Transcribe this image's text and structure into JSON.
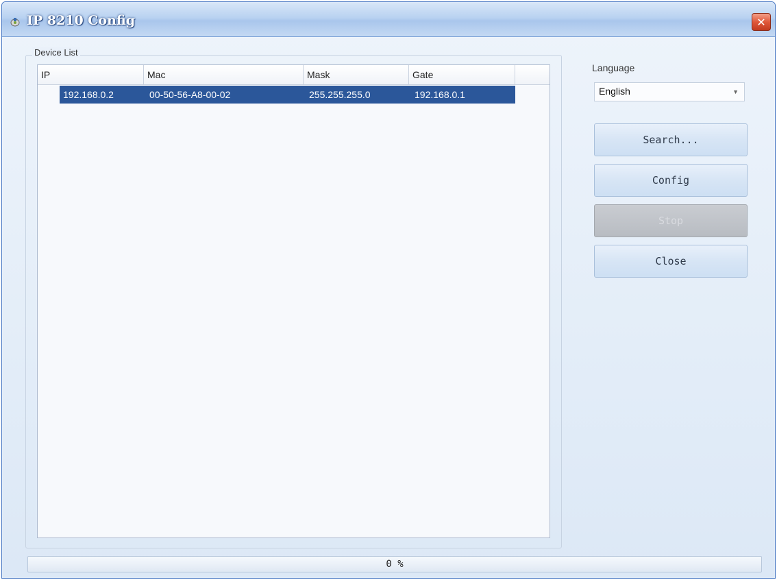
{
  "window": {
    "title": "IP 8210 Config",
    "close_glyph": "✕",
    "icons": {
      "app": "app-icon",
      "close": "close-icon"
    }
  },
  "device_list": {
    "label": "Device List",
    "columns": [
      "IP",
      "Mac",
      "Mask",
      "Gate"
    ],
    "rows": [
      {
        "ip": "192.168.0.2",
        "mac": "00-50-56-A8-00-02",
        "mask": "255.255.255.0",
        "gate": "192.168.0.1",
        "selected": true
      }
    ]
  },
  "language": {
    "label": "Language",
    "selected": "English",
    "dropdown_icon": "chevron-down-icon"
  },
  "buttons": {
    "search": "Search...",
    "config": "Config",
    "stop": "Stop",
    "close": "Close"
  },
  "progress": {
    "value": 0,
    "text": "0 %"
  },
  "colors": {
    "selection": "#2b579a",
    "title_text": "#ffffff",
    "close_button": "#e0583a"
  }
}
